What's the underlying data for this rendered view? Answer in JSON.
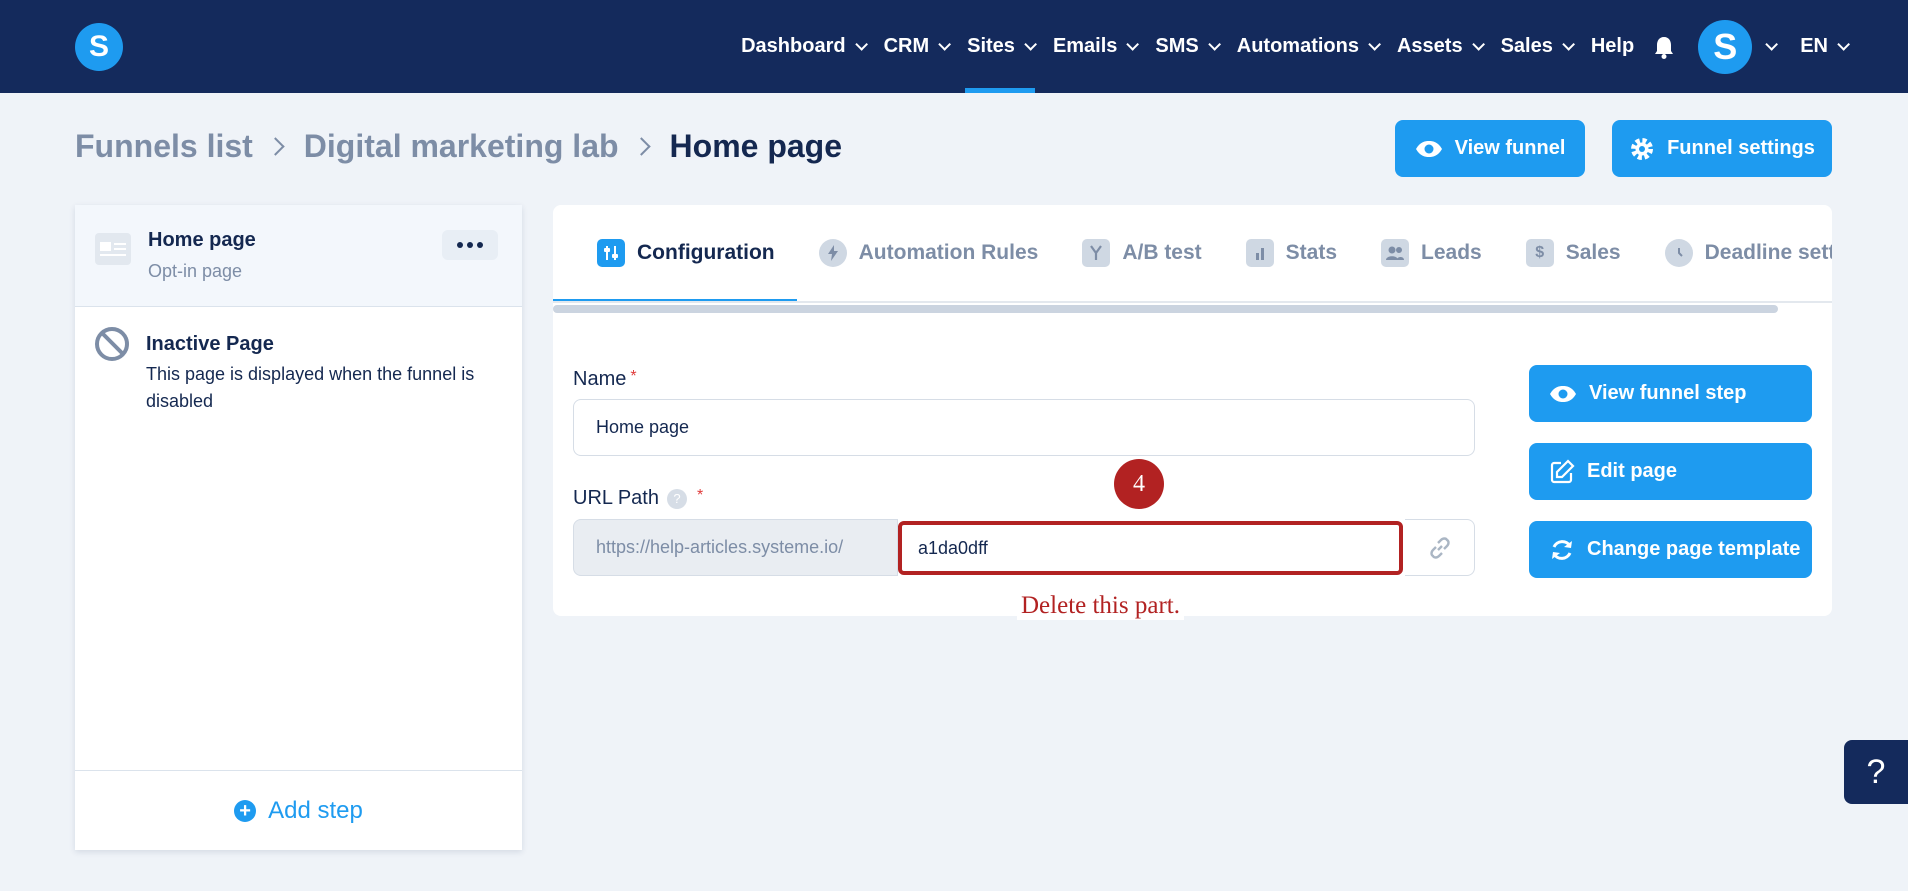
{
  "app": {
    "logo_letter": "S"
  },
  "nav": {
    "items": [
      {
        "label": "Dashboard"
      },
      {
        "label": "CRM"
      },
      {
        "label": "Sites"
      },
      {
        "label": "Emails"
      },
      {
        "label": "SMS"
      },
      {
        "label": "Automations"
      },
      {
        "label": "Assets"
      },
      {
        "label": "Sales"
      }
    ],
    "help": "Help",
    "avatar_letter": "S",
    "language": "EN",
    "active": "Sites"
  },
  "breadcrumb": {
    "items": [
      "Funnels list",
      "Digital marketing lab"
    ],
    "current": "Home page"
  },
  "header_actions": {
    "view_funnel": "View funnel",
    "funnel_settings": "Funnel settings"
  },
  "steps": {
    "active": {
      "title": "Home page",
      "type": "Opt-in page"
    },
    "inactive": {
      "title": "Inactive Page",
      "description": "This page is displayed when the funnel is disabled"
    },
    "add_step": "Add step"
  },
  "tabs": [
    {
      "label": "Configuration",
      "icon": "sliders-icon"
    },
    {
      "label": "Automation Rules",
      "icon": "bolt-icon"
    },
    {
      "label": "A/B test",
      "icon": "split-icon"
    },
    {
      "label": "Stats",
      "icon": "bar-chart-icon"
    },
    {
      "label": "Leads",
      "icon": "users-icon"
    },
    {
      "label": "Sales",
      "icon": "dollar-icon"
    },
    {
      "label": "Deadline setti",
      "icon": "clock-icon"
    }
  ],
  "form": {
    "name_label": "Name",
    "name_value": "Home page",
    "url_label": "URL Path",
    "url_prefix": "https://help-articles.systeme.io/",
    "url_slug": "a1da0dff",
    "required_mark": "*",
    "help_mark": "?"
  },
  "actions": {
    "view_step": "View funnel step",
    "edit_page": "Edit page",
    "change_template": "Change page template"
  },
  "annotation": {
    "step_number": "4",
    "note": "Delete this part."
  },
  "help_widget": "?",
  "colors": {
    "nav_bg": "#142a5c",
    "accent": "#1e9bf0",
    "annotation": "#b22222"
  }
}
